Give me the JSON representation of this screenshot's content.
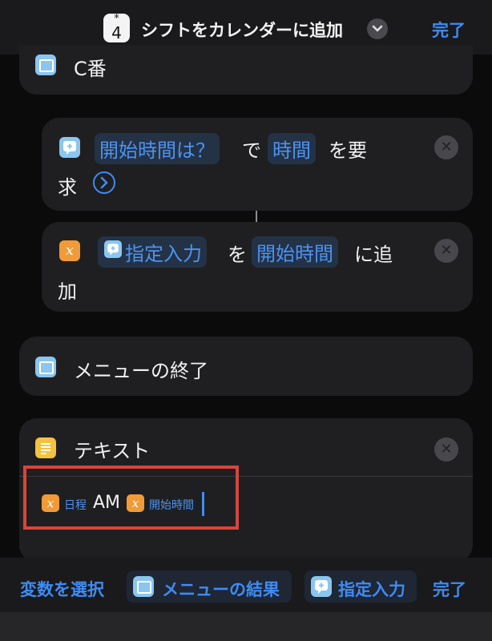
{
  "header": {
    "app_badge_star": "*",
    "app_badge_number": "4",
    "title": "シフトをカレンダーに追加",
    "done": "完了"
  },
  "actions": {
    "c_ban": "C番",
    "ask": {
      "prompt": "開始時間は？",
      "de": "で",
      "time": "時間",
      "wo_you": "を要",
      "kyu": "求"
    },
    "add": {
      "specified_input": "指定入力",
      "wo": "を",
      "start_time": "開始時間",
      "ni_tsui": "に追",
      "ka": "加"
    },
    "menu_end": "メニューの終了",
    "text": {
      "title": "テキスト",
      "var1": "日程",
      "am": "AM",
      "var2": "開始時間"
    }
  },
  "bottom_bar": {
    "select_variable": "変数を選択",
    "menu_result": "メニューの結果",
    "specified_input": "指定入力",
    "done": "完了"
  },
  "icons": {
    "variable": "x"
  }
}
